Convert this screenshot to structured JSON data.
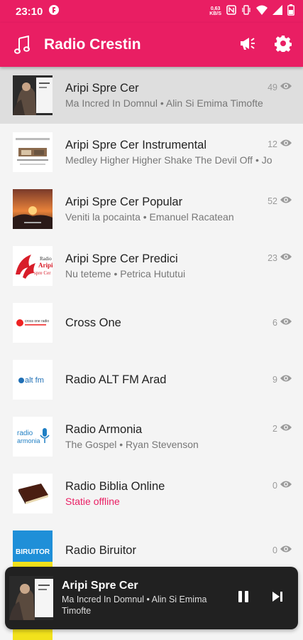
{
  "status": {
    "time": "23:10",
    "kb_value": "0,63",
    "kb_unit": "KB/S"
  },
  "app": {
    "title": "Radio Crestin"
  },
  "stations": [
    {
      "name": "Aripi Spre Cer",
      "sub": "Ma Incred In Domnul • Alin Si Emima Timofte",
      "count": "49",
      "offline": false,
      "thumb": "couple-photo",
      "selected": true
    },
    {
      "name": "Aripi Spre Cer Instrumental",
      "sub": "Medley  Higher Higher Shake The Devil Off • Jo",
      "count": "12",
      "offline": false,
      "thumb": "piano-cover",
      "selected": false
    },
    {
      "name": "Aripi Spre Cer Popular",
      "sub": "Veniti la pocainta • Emanuel Racatean",
      "count": "52",
      "offline": false,
      "thumb": "sunset-cover",
      "selected": false
    },
    {
      "name": "Aripi Spre Cer Predici",
      "sub": "Nu teteme • Petrica Hututui",
      "count": "23",
      "offline": false,
      "thumb": "wings-logo",
      "selected": false
    },
    {
      "name": "Cross One",
      "sub": "",
      "count": "6",
      "offline": false,
      "thumb": "crossone-logo",
      "selected": false
    },
    {
      "name": "Radio ALT FM Arad",
      "sub": "",
      "count": "9",
      "offline": false,
      "thumb": "altfm-logo",
      "selected": false
    },
    {
      "name": "Radio Armonia",
      "sub": "The Gospel • Ryan Stevenson",
      "count": "2",
      "offline": false,
      "thumb": "armonia-logo",
      "selected": false
    },
    {
      "name": "Radio Biblia Online",
      "sub": "Statie offline",
      "count": "0",
      "offline": true,
      "thumb": "bible-image",
      "selected": false
    },
    {
      "name": "Radio Biruitor",
      "sub": "",
      "count": "0",
      "offline": false,
      "thumb": "biruitor-logo",
      "selected": false
    }
  ],
  "thumb_text": {
    "wings_line1": "Radio",
    "wings_line2": "Aripi",
    "wings_line3": "spre Cer",
    "crossone": "cross one radio",
    "altfm": "alt fm",
    "armonia_line1": "radio",
    "armonia_line2": "armonia",
    "biruitor": "BIRUITOR"
  },
  "player": {
    "title": "Aripi Spre Cer",
    "sub": "Ma Incred In Domnul • Alin Si Emima Timofte"
  },
  "colors": {
    "primary": "#e91e63",
    "player_bg": "#212121",
    "selected_row": "#dedede"
  }
}
